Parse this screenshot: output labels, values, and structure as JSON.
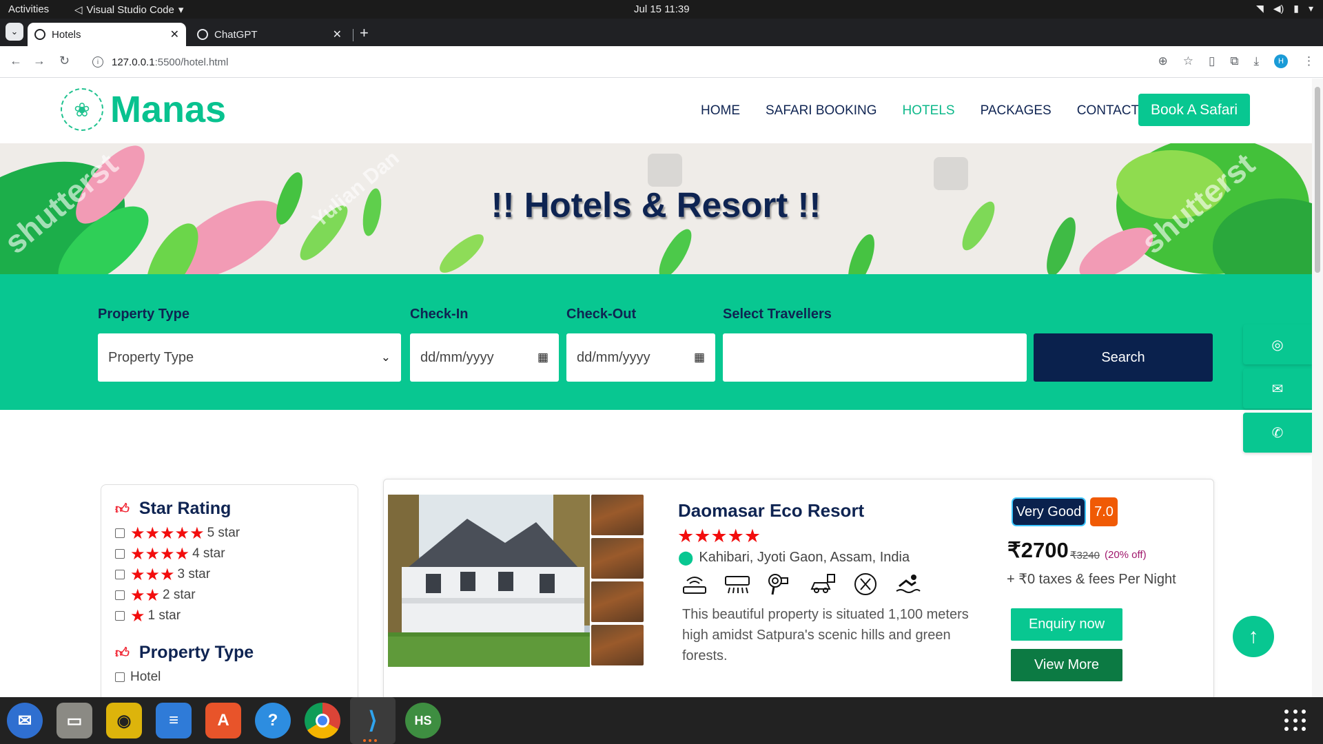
{
  "os": {
    "activities": "Activities",
    "active_app": "Visual Studio Code",
    "clock": "Jul 15  11:39"
  },
  "browser": {
    "tabs": [
      {
        "title": "Hotels",
        "active": true
      },
      {
        "title": "ChatGPT",
        "active": false
      }
    ],
    "url_host": "127.0.0.1",
    "url_path": ":5500/hotel.html",
    "profile_initial": "H"
  },
  "site": {
    "brand": "Manas",
    "menu": [
      "HOME",
      "SAFARI BOOKING",
      "HOTELS",
      "PACKAGES",
      "CONTACT"
    ],
    "active_menu": "HOTELS",
    "book_button": "Book A Safari",
    "banner_title": "!! Hotels & Resort !!",
    "banner_watermarks": [
      "shutterst",
      "Yulian Dan",
      "shutterst"
    ]
  },
  "search": {
    "property_label": "Property Type",
    "property_value": "Property Type",
    "checkin_label": "Check-In",
    "checkin_placeholder": "dd/mm/yyyy",
    "checkout_label": "Check-Out",
    "checkout_placeholder": "dd/mm/yyyy",
    "travellers_label": "Select Travellers",
    "travellers_value": "",
    "button": "Search"
  },
  "filters": {
    "star_title": "Star Rating",
    "ratings": [
      {
        "stars": 5,
        "label": "5 star"
      },
      {
        "stars": 4,
        "label": "4 star"
      },
      {
        "stars": 3,
        "label": "3 star"
      },
      {
        "stars": 2,
        "label": "2 star"
      },
      {
        "stars": 1,
        "label": "1 star"
      }
    ],
    "property_title": "Property Type",
    "property_options": [
      "Hotel"
    ]
  },
  "hotel": {
    "name": "Daomasar Eco Resort",
    "stars": 5,
    "location": "Kahibari, Jyoti Gaon, Assam, India",
    "amenities": [
      "wifi-router-icon",
      "air-conditioner-icon",
      "hair-dryer-icon",
      "car-parking-icon",
      "restaurant-icon",
      "swimming-icon"
    ],
    "description": "This beautiful property is situated 1,100 meters high amidst Satpura's scenic hills and green forests.",
    "rating_text": "Very Good",
    "rating_score": "7.0",
    "price": "₹2700",
    "old_price": "₹3240",
    "discount": "(20% off)",
    "taxes": "+ ₹0 taxes & fees Per Night",
    "enquiry_button": "Enquiry now",
    "view_button": "View More"
  },
  "colors": {
    "brand_green": "#08c791",
    "navy": "#0a214d",
    "star_red": "#f20d0d",
    "score_orange": "#f05a05",
    "view_green": "#0c7a43"
  }
}
